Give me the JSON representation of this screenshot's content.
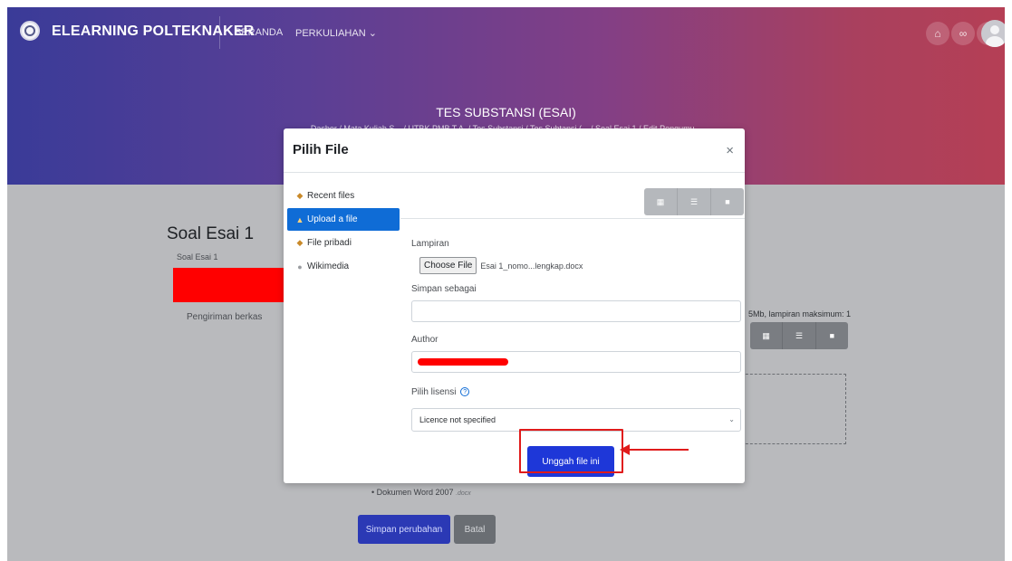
{
  "navbar": {
    "site_name": "ELEARNING POLTEKNAKER",
    "links": {
      "beranda": "BERANDA",
      "perkuliahan": "PERKULIAHAN ⌄"
    }
  },
  "header": {
    "title": "TES SUBSTANSI (ESAI)",
    "breadcrumb": "Dasbor / Mata Kuliah S... / UTBK PMB T.A. / Tes Substansi / Tes Subtansi (... / Soal Esai 1 / Edit Pengumu..."
  },
  "page": {
    "question_title": "Soal Esai 1",
    "question_sub": "Soal Esai 1",
    "submission_label": "Pengiriman berkas",
    "file_limit_note": "5Mb, lampiran maksimum: 1",
    "accepted_type": "Dokumen Word 2007",
    "accepted_ext": ".docx",
    "save_button": "Simpan perubahan",
    "cancel_button": "Batal"
  },
  "modal": {
    "title": "Pilih File",
    "close": "×",
    "repositories": [
      {
        "label": "Recent files",
        "icon": "recent-files-icon"
      },
      {
        "label": "Upload a file",
        "icon": "upload-icon"
      },
      {
        "label": "File pribadi",
        "icon": "private-files-icon"
      },
      {
        "label": "Wikimedia",
        "icon": "wikimedia-icon"
      }
    ],
    "attachment_label": "Lampiran",
    "choose_file_button": "Choose File",
    "chosen_file_name": "Esai 1_nomo...lengkap.docx",
    "save_as_label": "Simpan sebagai",
    "save_as_value": "",
    "author_label": "Author",
    "license_label": "Pilih lisensi",
    "license_value": "Licence not specified",
    "upload_button": "Unggah file ini"
  },
  "colors": {
    "accent_blue": "#0f6cd6",
    "primary_button": "#1e37d8",
    "annotation_red": "#e01b1b"
  }
}
